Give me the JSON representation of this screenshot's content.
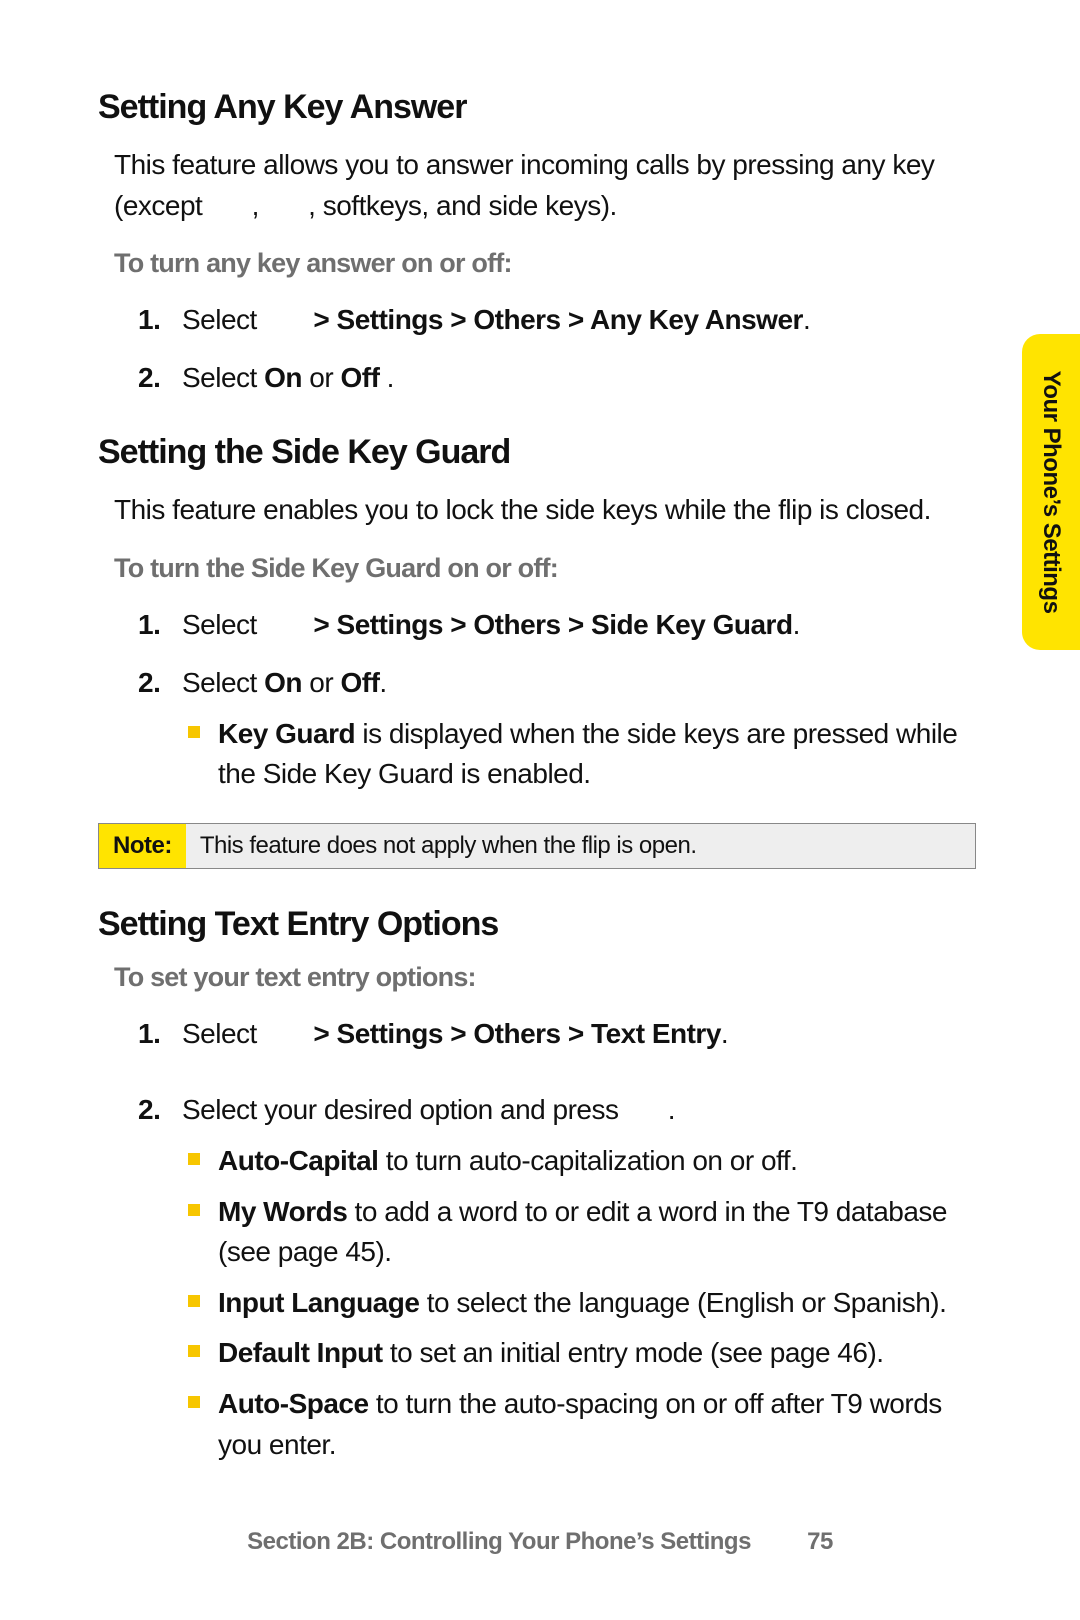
{
  "sideTab": "Your Phone’s Settings",
  "sections": [
    {
      "title": "Setting Any Key Answer",
      "intro_a": "This feature allows you to answer incoming calls by pressing any key (except ",
      "intro_b": ", ",
      "intro_c": ", softkeys, and side keys).",
      "sub": "To turn any key answer on or off:",
      "step1_a": "Select ",
      "step1_b": " > Settings > Others > Any Key Answer",
      "step1_c": ".",
      "step2_a": "Select ",
      "step2_b": "On",
      "step2_c": " or ",
      "step2_d": "Off",
      "step2_e": " ."
    },
    {
      "title": "Setting the Side Key Guard",
      "intro": "This feature enables you to lock the side keys while the flip is closed.",
      "sub": "To turn the Side Key Guard on or off:",
      "step1_a": "Select ",
      "step1_b": " > Settings > Others > Side Key Guard",
      "step1_c": ".",
      "step2_a": "Select ",
      "step2_b": "On",
      "step2_c": " or ",
      "step2_d": "Off",
      "step2_e": ".",
      "bullet_b": "Key Guard",
      "bullet_rest": " is displayed when the side keys are pressed while the Side Key Guard is enabled.",
      "noteLabel": "Note:",
      "noteText": "This feature does not apply when the flip is open."
    },
    {
      "title": "Setting Text Entry Options",
      "sub": "To set your text entry options:",
      "step1_a": "Select ",
      "step1_b": " > Settings > Others > Text Entry",
      "step1_c": ".",
      "step2": "Select your desired option and press ",
      "step2_end": ".",
      "opts": [
        {
          "b": "Auto-Capital",
          "rest": " to turn auto-capitalization on or off."
        },
        {
          "b": "My Words",
          "rest": " to add a word to or edit a word in the T9 database (see page 45)."
        },
        {
          "b": "Input Language",
          "rest": " to select the language (English or Spanish)."
        },
        {
          "b": "Default Input",
          "rest": " to set an initial entry mode (see page 46)."
        },
        {
          "b": "Auto-Space",
          "rest": " to turn the auto-spacing on or off after T9 words you enter."
        }
      ]
    }
  ],
  "footer": {
    "section": "Section 2B: Controlling Your Phone’s Settings",
    "page": "75"
  }
}
